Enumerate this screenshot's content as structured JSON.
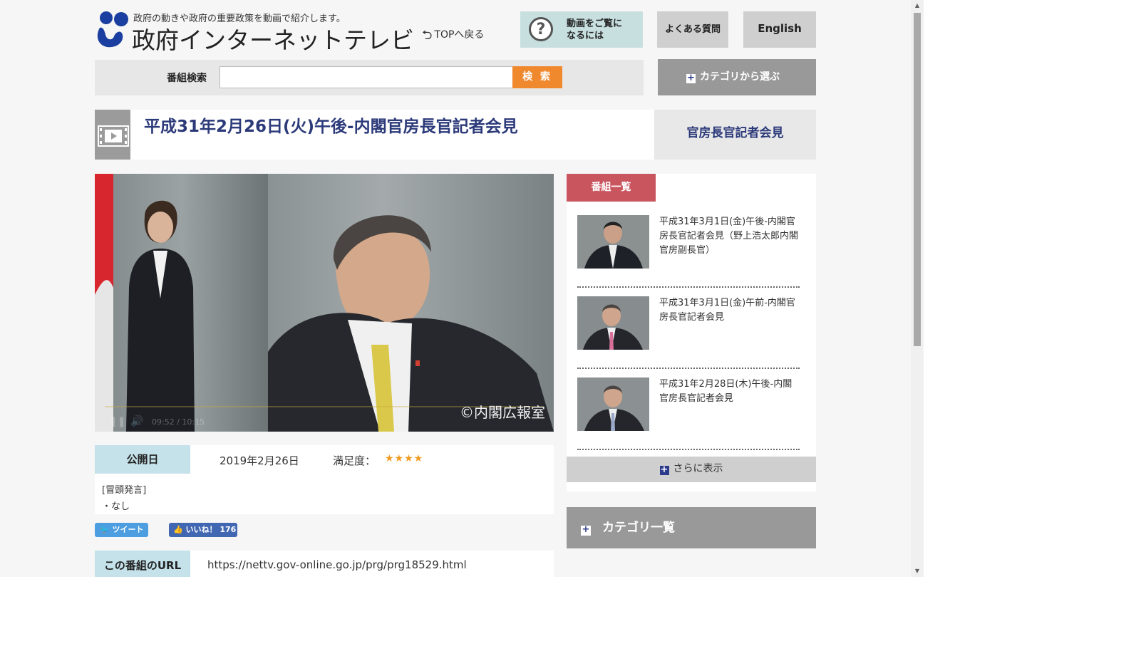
{
  "header": {
    "tagline": "政府の動きや政府の重要政策を動画で紹介します。",
    "site_title": "政府インターネットテレビ",
    "top_link": "TOPへ戻る",
    "help_line1": "動画をご覧に",
    "help_line2": "なるには",
    "faq": "よくある質問",
    "english": "English"
  },
  "search": {
    "label": "番組検索",
    "value": "",
    "placeholder": "",
    "button": "検 索",
    "category_button": "カテゴリから選ぶ"
  },
  "program": {
    "title": "平成31年2月26日(火)午後-内閣官房長官記者会見",
    "series": "官房長官記者会見",
    "copyright": "©内閣広報室",
    "player_time": "09:52 / 10:15",
    "date_label": "公開日",
    "date_value": "2019年2月26日",
    "satisfaction_label": "満足度：",
    "satisfaction_stars": "★★★★",
    "satisfaction_rating": 4,
    "description": "[冒頭発言]\n・なし",
    "tweet": "ツイート",
    "like": "いいね！ 176",
    "url_label": "この番組のURL",
    "url_value": "https://nettv.gov-online.go.jp/prg/prg18529.html"
  },
  "sidebar": {
    "list_title": "番組一覧",
    "items": [
      {
        "title": "平成31年3月1日(金)午後-内閣官房長官記者会見（野上浩太郎内閣官房副長官）"
      },
      {
        "title": "平成31年3月1日(金)午前-内閣官房長官記者会見"
      },
      {
        "title": "平成31年2月28日(木)午後-内閣官房長官記者会見"
      }
    ],
    "more": "さらに表示",
    "category_list": "カテゴリ一覧"
  },
  "colors": {
    "accent_orange": "#f0882e",
    "title_navy": "#2c3a7a",
    "list_header_red": "#c9555f",
    "label_blue": "#c5e2ea",
    "logo_blue": "#1a3fa0"
  }
}
